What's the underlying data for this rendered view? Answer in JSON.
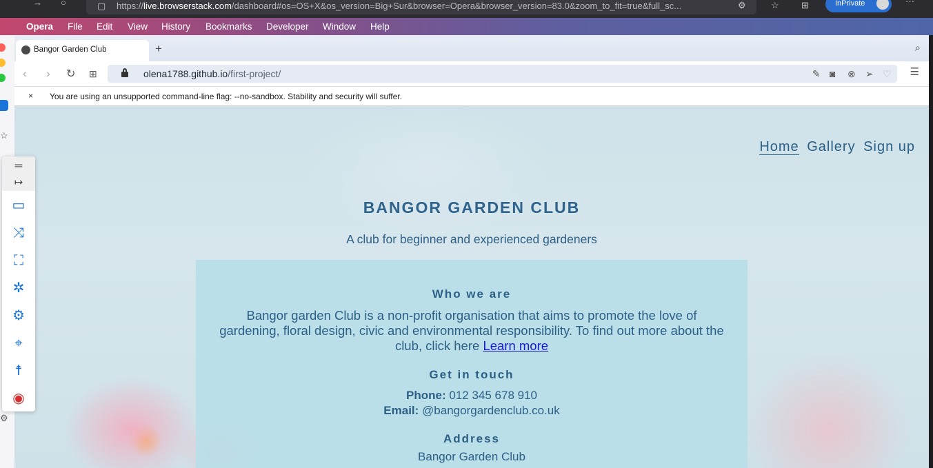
{
  "host": {
    "url_prefix": "https://",
    "url_host": "live.browserstack.com",
    "url_rest": "/dashboard#os=OS+X&os_version=Big+Sur&browser=Opera&browser_version=83.0&zoom_to_fit=true&full_sc...",
    "inprivate_label": "InPrivate"
  },
  "menubar": {
    "items": [
      "Opera",
      "File",
      "Edit",
      "View",
      "History",
      "Bookmarks",
      "Developer",
      "Window",
      "Help"
    ]
  },
  "browser": {
    "tab_title": "Bangor Garden Club",
    "url_host": "olena1788.github.io",
    "url_path": "/first-project/",
    "warning": "You are using an unsupported command-line flag: --no-sandbox. Stability and security will suffer.",
    "warning_close": "×"
  },
  "page": {
    "nav": [
      "Home",
      "Gallery",
      "Sign up"
    ],
    "title": "BANGOR GARDEN CLUB",
    "tagline": "A club for beginner and experienced gardeners",
    "who_heading": "Who we are",
    "who_text": "Bangor garden Club is a non-profit organisation that aims to promote the love of gardening, floral design, civic and environmental responsibility. To find out more about the club, click here",
    "learn_more": "Learn more",
    "contact_heading": "Get in touch",
    "phone_label": "Phone:",
    "phone_value": "012 345 678 910",
    "email_label": "Email:",
    "email_value": "@bangorgardenclub.co.uk",
    "address_heading": "Address",
    "address_line1": "Bangor Garden Club"
  },
  "colors": {
    "heading_blue": "#30648d",
    "link_blue": "#1a1ad0",
    "box_bg": "#b8dee8"
  }
}
